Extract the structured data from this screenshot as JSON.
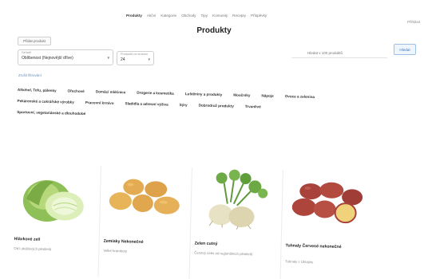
{
  "nav": {
    "items": [
      "Produkty",
      "Akční",
      "Kategorie",
      "Obchody",
      "Tipy",
      "Komunity",
      "Recepty",
      "Příspěvky"
    ],
    "active_index": 0,
    "right_label": "Přihlásit"
  },
  "page_title": "Produkty",
  "add_button": "Přidat produkt",
  "search": {
    "placeholder": "Hledat v 100 produktů",
    "button": "Hledat"
  },
  "sort": {
    "label": "Seřadit",
    "value": "Oblíbenost (Nejnovější dříve)"
  },
  "per_page": {
    "label": "Produktů na stránku",
    "value": "24"
  },
  "reset_link": "Zrušit filtrování",
  "categories": [
    [
      "Alkohol, Tofu, pálenky",
      "Ořechové",
      "Domácí mléčnice",
      "Drogerie a kosmetika",
      "Luštěniny a produkty",
      "Moučníky",
      "Nápoje",
      "Ovoce a zelenina"
    ],
    [
      "Pekárenské a cukrářské výrobky",
      "Pracovní krmivo",
      "Sladidla a adresní výživa",
      "Sýry",
      "Dobrodruž produkty",
      "Trvanlivé"
    ],
    [
      "Sportovní, vegetariánské a dlouhodobé"
    ]
  ],
  "products": [
    {
      "name": "Hlávkové zelí",
      "desc": "Od Lukášových pěstitelů"
    },
    {
      "name": "Zemiaky Nekonečné",
      "desc": "Velké brambory"
    },
    {
      "name": "Zelen cutný",
      "desc": "Čerstvý celer od regionálních pěstitelů"
    },
    {
      "name": "Tuhnaly Červené nekonečné",
      "desc": "Tuhnaly z Ukrajiny"
    }
  ]
}
